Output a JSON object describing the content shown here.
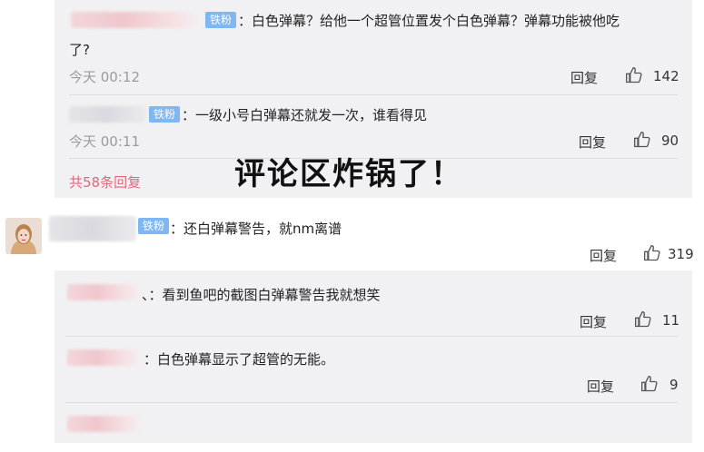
{
  "top_thread": {
    "comments": [
      {
        "badge": "铁粉",
        "text_line1": "：白色弹幕？给他一个超管位置发个白色弹幕？弹幕功能被他吃",
        "text_line2": "了?",
        "time": "今天 00:12",
        "reply": "回复",
        "likes": "142"
      },
      {
        "badge": "铁粉",
        "text": "：一级小号白弹幕还就发一次，谁看得见",
        "time": "今天 00:11",
        "reply": "回复",
        "likes": "90"
      }
    ],
    "more_replies": "共58条回复"
  },
  "overlay_text": "评论区炸锅了！",
  "second_thread": {
    "main": {
      "badge": "铁粉",
      "text": "：还白弹幕警告，就nm离谱",
      "reply": "回复",
      "likes": "319"
    },
    "replies": [
      {
        "text": "、：看到鱼吧的截图白弹幕警告我就想笑",
        "reply": "回复",
        "likes": "11"
      },
      {
        "text": "：白色弹幕显示了超管的无能。",
        "reply": "回复",
        "likes": "9"
      }
    ]
  },
  "icons": {
    "like": "thumbs-up-icon",
    "avatar": "user-avatar"
  },
  "colors": {
    "badge": "#7fb7f4",
    "more_link": "#e0687a",
    "panel": "#f1f1f3"
  }
}
